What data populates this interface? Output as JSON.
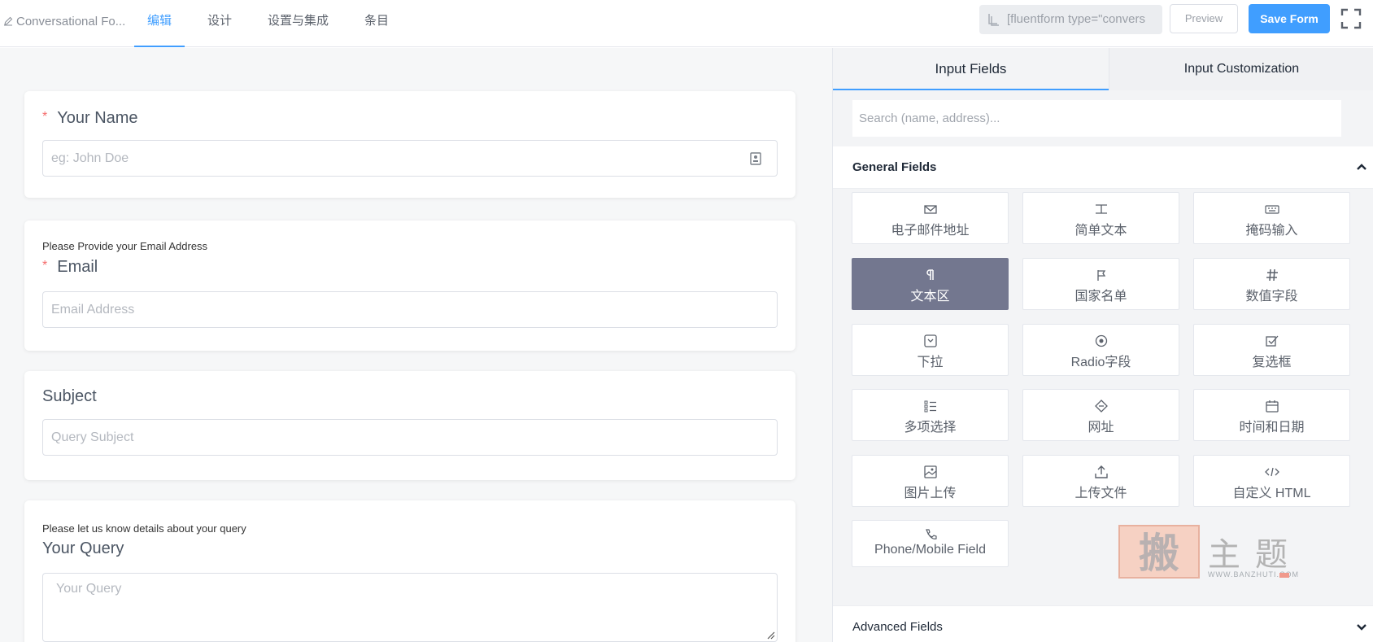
{
  "header": {
    "form_title": "Conversational Fo...",
    "tabs": [
      {
        "label": "编辑",
        "active": true
      },
      {
        "label": "设计",
        "active": false
      },
      {
        "label": "设置与集成",
        "active": false
      },
      {
        "label": "条目",
        "active": false
      }
    ],
    "shortcode": "[fluentform type=\"convers",
    "preview_label": "Preview",
    "save_label": "Save Form"
  },
  "form": {
    "name": {
      "label": "Your Name",
      "required": true,
      "placeholder": "eg: John Doe"
    },
    "email": {
      "help": "Please Provide your Email Address",
      "label": "Email",
      "required": true,
      "placeholder": "Email Address"
    },
    "subject": {
      "label": "Subject",
      "placeholder": "Query Subject"
    },
    "query": {
      "help": "Please let us know details about your query",
      "label": "Your Query",
      "placeholder": "Your Query"
    }
  },
  "panel": {
    "tabs": [
      {
        "label": "Input Fields",
        "active": true
      },
      {
        "label": "Input Customization",
        "active": false
      }
    ],
    "search_placeholder": "Search (name, address)...",
    "general_fields_title": "General Fields",
    "general_fields": [
      {
        "label": "电子邮件地址",
        "icon": "envelope-icon"
      },
      {
        "label": "简单文本",
        "icon": "text-icon"
      },
      {
        "label": "掩码输入",
        "icon": "keyboard-icon"
      },
      {
        "label": "文本区",
        "icon": "paragraph-icon",
        "selected": true
      },
      {
        "label": "国家名单",
        "icon": "flag-icon"
      },
      {
        "label": "数值字段",
        "icon": "hash-icon"
      },
      {
        "label": "下拉",
        "icon": "dropdown-icon"
      },
      {
        "label": "Radio字段",
        "icon": "radio-icon"
      },
      {
        "label": "复选框",
        "icon": "checkbox-icon"
      },
      {
        "label": "多项选择",
        "icon": "list-icon"
      },
      {
        "label": "网址",
        "icon": "link-icon"
      },
      {
        "label": "时间和日期",
        "icon": "calendar-icon"
      },
      {
        "label": "图片上传",
        "icon": "image-icon"
      },
      {
        "label": "上传文件",
        "icon": "upload-icon"
      },
      {
        "label": "自定义 HTML",
        "icon": "code-icon"
      },
      {
        "label": "Phone/Mobile Field",
        "icon": "phone-icon"
      }
    ],
    "advanced_fields_title": "Advanced Fields"
  },
  "watermark": {
    "brand": "搬主题",
    "url": "WWW.BANZHUTI.COM"
  },
  "colors": {
    "accent": "#409eff",
    "selected_field": "#73778f",
    "required": "#f56c6c"
  }
}
